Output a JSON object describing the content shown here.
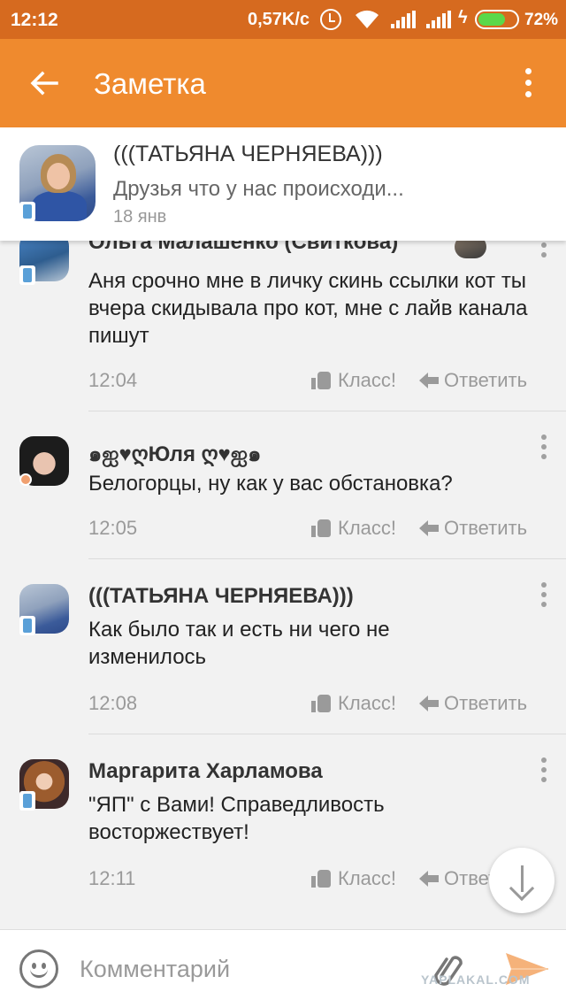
{
  "status_bar": {
    "time": "12:12",
    "speed": "0,57K/c",
    "battery": "72%",
    "battery_level": 0.72
  },
  "toolbar": {
    "title": "Заметка"
  },
  "note": {
    "author": "(((ТАТЬЯНА ЧЕРНЯЕВА)))",
    "text": "Друзья что у нас происходи...",
    "date": "18 янв"
  },
  "comments": [
    {
      "author": "Ольга Малашенко (Свиткова)",
      "text": "Аня срочно мне в личку скинь ссылки кот ты вчера скидывала про кот, мне с лайв канала пишут",
      "time": "12:04",
      "like_label": "Класс!",
      "reply_label": "Ответить"
    },
    {
      "author": "๑ஐ♥ღЮля ღ♥ஐ๑",
      "text": "Белогорцы, ну как у вас обстановка?",
      "time": "12:05",
      "like_label": "Класс!",
      "reply_label": "Ответить"
    },
    {
      "author": "(((ТАТЬЯНА ЧЕРНЯЕВА)))",
      "text": "Как было так и есть ни чего не изменилось",
      "time": "12:08",
      "like_label": "Класс!",
      "reply_label": "Ответить"
    },
    {
      "author": "Маргарита Харламова",
      "text": "\"ЯП\" с Вами! Справедливость восторжествует!",
      "time": "12:11",
      "like_label": "Класс!",
      "reply_label": "Ответить"
    }
  ],
  "input": {
    "placeholder": "Комментарий"
  },
  "watermark": "YAPLAKAL.COM",
  "colors": {
    "toolbar": "#ef8a2e",
    "status_bar": "#d66a1f",
    "send": "#f5b27a"
  }
}
